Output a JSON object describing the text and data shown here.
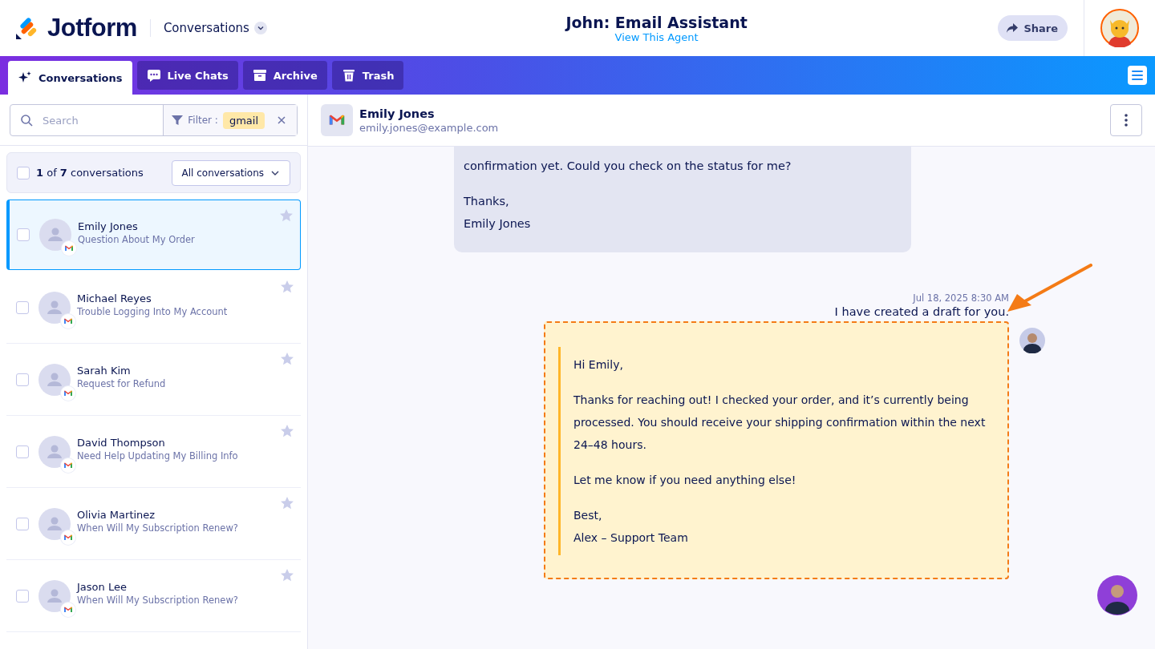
{
  "header": {
    "logo": "Jotform",
    "section_menu": "Conversations",
    "agent_title": "John: Email Assistant",
    "agent_link": "View This Agent",
    "share_button": "Share"
  },
  "tabs": [
    {
      "label": "Conversations",
      "kind": "sparkle",
      "selected": true
    },
    {
      "label": "Live Chats",
      "kind": "chat",
      "selected": false
    },
    {
      "label": "Archive",
      "kind": "archive",
      "selected": false
    },
    {
      "label": "Trash",
      "kind": "trash",
      "selected": false
    }
  ],
  "sidebar": {
    "search": {
      "placeholder": "Search"
    },
    "filter_label": "Filter :",
    "filter_value": "gmail",
    "select_all_checked": false,
    "summary": "**1** of **7** conversations",
    "view_dropdown": "All conversations",
    "conversations": [
      {
        "name": "Emily Jones",
        "subject": "Question About My Order",
        "selected": true,
        "checked": false,
        "starred": false
      },
      {
        "name": "Michael Reyes",
        "subject": "Trouble Logging Into My Account",
        "selected": false,
        "checked": false,
        "starred": false
      },
      {
        "name": "Sarah Kim",
        "subject": "Request for Refund",
        "selected": false,
        "checked": false,
        "starred": false
      },
      {
        "name": "David Thompson",
        "subject": "Need Help Updating My Billing Info",
        "selected": false,
        "checked": false,
        "starred": false
      },
      {
        "name": "Olivia Martinez",
        "subject": "When Will My Subscription Renew?",
        "selected": false,
        "checked": false,
        "starred": false
      },
      {
        "name": "Jason Lee",
        "subject": "When Will My Subscription Renew?",
        "selected": false,
        "checked": false,
        "starred": false
      }
    ]
  },
  "chat": {
    "contact_name": "Emily Jones",
    "contact_email": "emily.jones@example.com",
    "messages": [
      {
        "kind": "incoming",
        "paragraphs": [
          "confirmation yet. Could you check on the status for me?",
          "Thanks,\nEmily Jones"
        ]
      },
      {
        "kind": "agent",
        "time": "Jul 18, 2025 8:30 AM",
        "text": "I have created a draft for you.",
        "draft": [
          "Hi Emily,",
          "Thanks for reaching out! I checked your order, and it’s currently being processed. You should receive your shipping confirmation within the next 24–48 hours.",
          "Let me know if you need anything else!",
          "Best,\nAlex – Support Team"
        ]
      }
    ]
  }
}
